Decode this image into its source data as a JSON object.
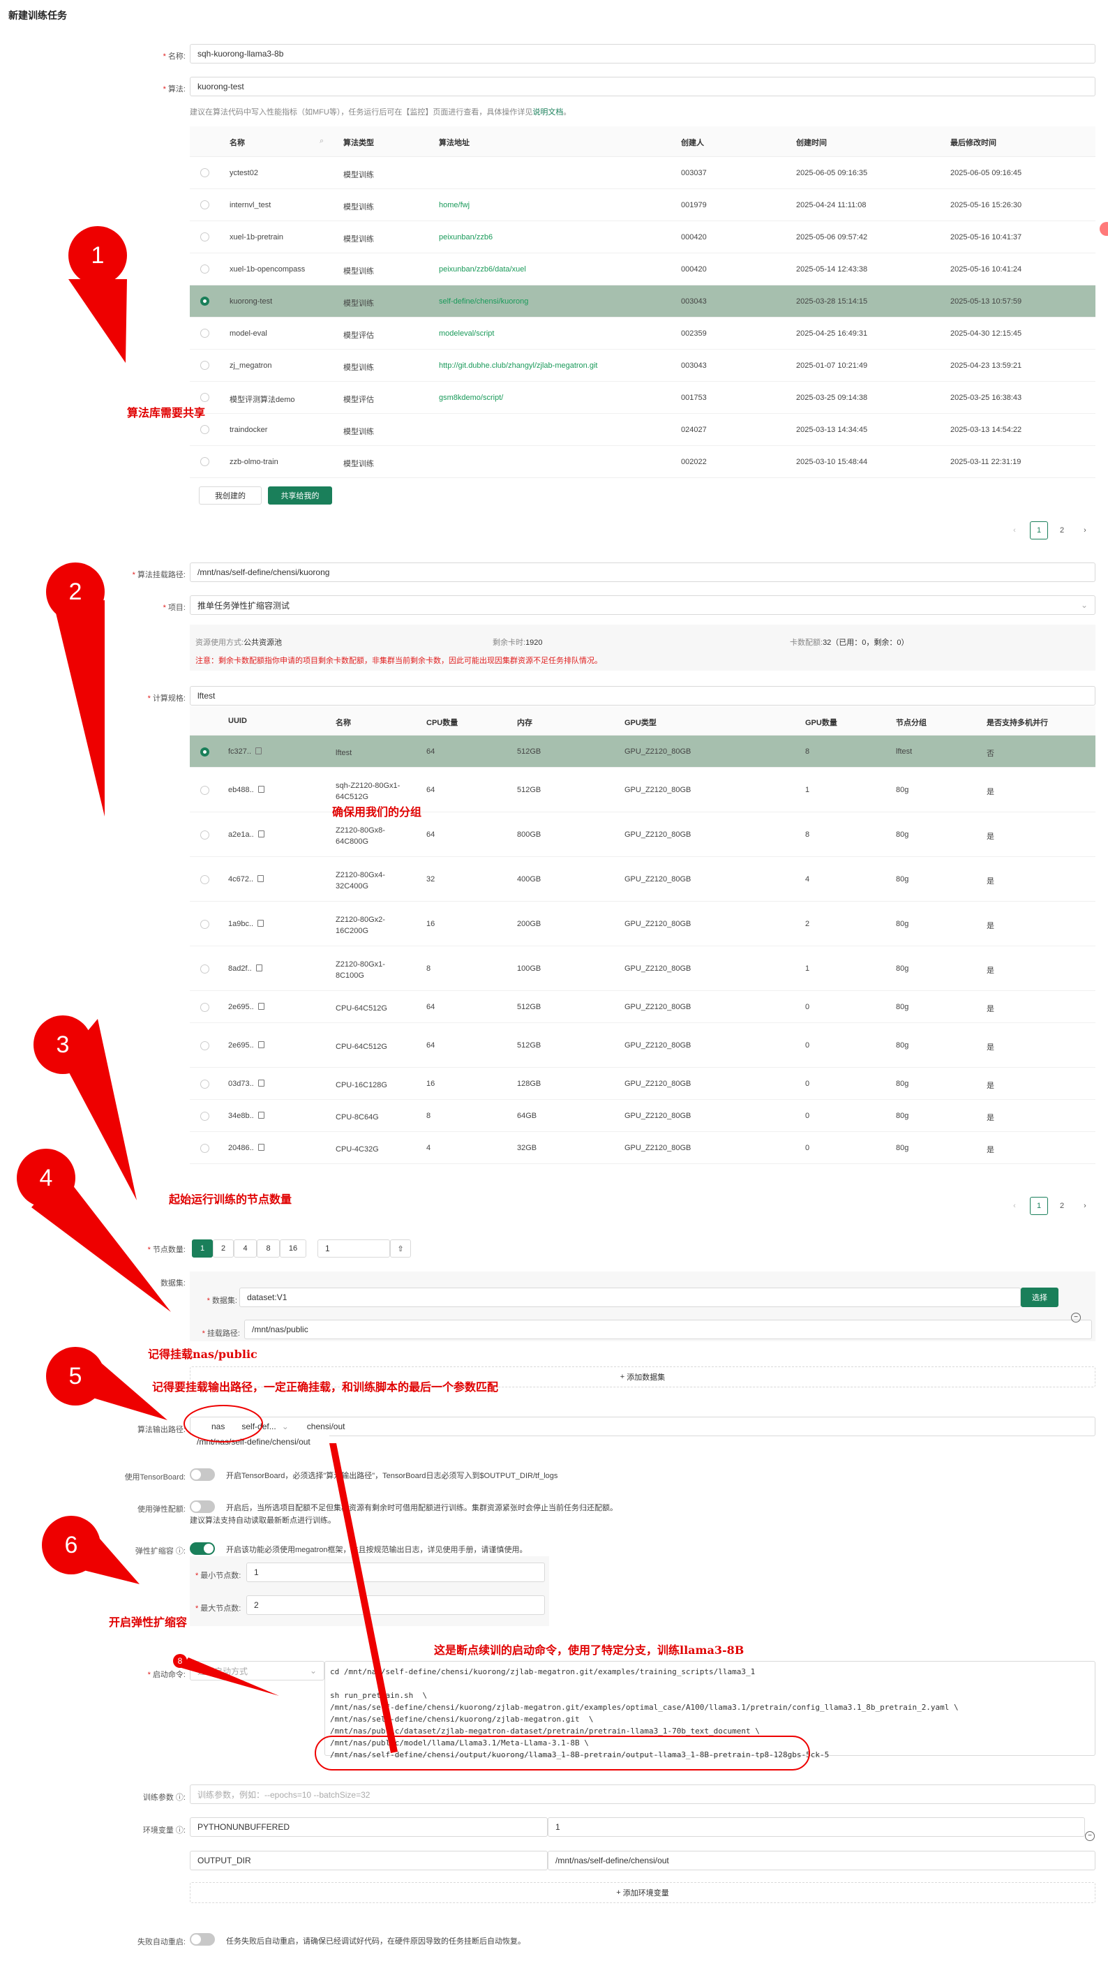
{
  "page_title": "新建训练任务",
  "form": {
    "name_label": "名称:",
    "name_value": "sqh-kuorong-llama3-8b",
    "algo_label": "算法:",
    "algo_value": "kuorong-test",
    "algo_hint_pre": "建议在算法代码中写入性能指标（如MFU等），任务运行后可在【监控】页面进行查看，具体操作详见",
    "algo_hint_link": "说明文档",
    "algo_hint_post": "。"
  },
  "algo_table": {
    "headers": [
      "名称",
      "算法类型",
      "算法地址",
      "创建人",
      "创建时间",
      "最后修改时间"
    ],
    "rows": [
      {
        "name": "yctest02",
        "type": "模型训练",
        "addr": "",
        "creator": "003037",
        "created": "2025-06-05 09:16:35",
        "modified": "2025-06-05 09:16:45"
      },
      {
        "name": "internvl_test",
        "type": "模型训练",
        "addr": "home/fwj",
        "creator": "001979",
        "created": "2025-04-24 11:11:08",
        "modified": "2025-05-16 15:26:30"
      },
      {
        "name": "xuel-1b-pretrain",
        "type": "模型训练",
        "addr": "peixunban/zzb6",
        "creator": "000420",
        "created": "2025-05-06 09:57:42",
        "modified": "2025-05-16 10:41:37"
      },
      {
        "name": "xuel-1b-opencompass",
        "type": "模型训练",
        "addr": "peixunban/zzb6/data/xuel",
        "creator": "000420",
        "created": "2025-05-14 12:43:38",
        "modified": "2025-05-16 10:41:24"
      },
      {
        "name": "kuorong-test",
        "type": "模型训练",
        "addr": "self-define/chensi/kuorong",
        "creator": "003043",
        "created": "2025-03-28 15:14:15",
        "modified": "2025-05-13 10:57:59"
      },
      {
        "name": "model-eval",
        "type": "模型评估",
        "addr": "modeleval/script",
        "creator": "002359",
        "created": "2025-04-25 16:49:31",
        "modified": "2025-04-30 12:15:45"
      },
      {
        "name": "zj_megatron",
        "type": "模型训练",
        "addr": "http://git.dubhe.club/zhangyl/zjlab-megatron.git",
        "creator": "003043",
        "created": "2025-01-07 10:21:49",
        "modified": "2025-04-23 13:59:21"
      },
      {
        "name": "模型评测算法demo",
        "type": "模型评估",
        "addr": "gsm8kdemo/script/",
        "creator": "001753",
        "created": "2025-03-25 09:14:38",
        "modified": "2025-03-25 16:38:43"
      },
      {
        "name": "traindocker",
        "type": "模型训练",
        "addr": "",
        "creator": "024027",
        "created": "2025-03-13 14:34:45",
        "modified": "2025-03-13 14:54:22"
      },
      {
        "name": "zzb-olmo-train",
        "type": "模型训练",
        "addr": "",
        "creator": "002022",
        "created": "2025-03-10 15:48:44",
        "modified": "2025-03-11 22:31:19"
      }
    ],
    "tab_mine": "我创建的",
    "tab_shared": "共享给我的",
    "pages": [
      "1",
      "2"
    ]
  },
  "mount": {
    "label": "算法挂载路径:",
    "value": "/mnt/nas/self-define/chensi/kuorong",
    "project_label": "项目:",
    "project_value": "推单任务弹性扩缩容测试",
    "res_mode_label": "资源使用方式:",
    "res_mode_value": "公共资源池",
    "remain_label": "剩余卡时:",
    "remain_value": "1920",
    "quota_label": "卡数配额:",
    "quota_value": "32（已用：0，剩余：0）",
    "warning": "注意：剩余卡数配额指你申请的项目剩余卡数配额，非集群当前剩余卡数，因此可能出现因集群资源不足任务排队情况。"
  },
  "compute": {
    "label": "计算规格:",
    "search_value": "lftest",
    "headers": [
      "UUID",
      "名称",
      "CPU数量",
      "内存",
      "GPU类型",
      "GPU数量",
      "节点分组",
      "是否支持多机并行"
    ],
    "rows": [
      {
        "uuid": "fc327..",
        "name": "lftest",
        "name2": "",
        "cpu": "64",
        "mem": "512GB",
        "gpu": "GPU_Z2120_80GB",
        "gpun": "8",
        "group": "lftest",
        "multi": "否"
      },
      {
        "uuid": "eb488..",
        "name": "sqh-Z2120-80Gx1-",
        "name2": "64C512G",
        "cpu": "64",
        "mem": "512GB",
        "gpu": "GPU_Z2120_80GB",
        "gpun": "1",
        "group": "80g",
        "multi": "是"
      },
      {
        "uuid": "a2e1a..",
        "name": "Z2120-80Gx8-",
        "name2": "64C800G",
        "cpu": "64",
        "mem": "800GB",
        "gpu": "GPU_Z2120_80GB",
        "gpun": "8",
        "group": "80g",
        "multi": "是"
      },
      {
        "uuid": "4c672..",
        "name": "Z2120-80Gx4-",
        "name2": "32C400G",
        "cpu": "32",
        "mem": "400GB",
        "gpu": "GPU_Z2120_80GB",
        "gpun": "4",
        "group": "80g",
        "multi": "是"
      },
      {
        "uuid": "1a9bc..",
        "name": "Z2120-80Gx2-",
        "name2": "16C200G",
        "cpu": "16",
        "mem": "200GB",
        "gpu": "GPU_Z2120_80GB",
        "gpun": "2",
        "group": "80g",
        "multi": "是"
      },
      {
        "uuid": "8ad2f..",
        "name": "Z2120-80Gx1-",
        "name2": "8C100G",
        "cpu": "8",
        "mem": "100GB",
        "gpu": "GPU_Z2120_80GB",
        "gpun": "1",
        "group": "80g",
        "multi": "是"
      },
      {
        "uuid": "2e695..",
        "name": "CPU-64C512G",
        "name2": "",
        "cpu": "64",
        "mem": "512GB",
        "gpu": "GPU_Z2120_80GB",
        "gpun": "0",
        "group": "80g",
        "multi": "是"
      },
      {
        "uuid": "2e695..",
        "name": "CPU-64C512G",
        "name2": "",
        "cpu": "64",
        "mem": "512GB",
        "gpu": "GPU_Z2120_80GB",
        "gpun": "0",
        "group": "80g",
        "multi": "是"
      },
      {
        "uuid": "03d73..",
        "name": "CPU-16C128G",
        "name2": "",
        "cpu": "16",
        "mem": "128GB",
        "gpu": "GPU_Z2120_80GB",
        "gpun": "0",
        "group": "80g",
        "multi": "是"
      },
      {
        "uuid": "34e8b..",
        "name": "CPU-8C64G",
        "name2": "",
        "cpu": "8",
        "mem": "64GB",
        "gpu": "GPU_Z2120_80GB",
        "gpun": "0",
        "group": "80g",
        "multi": "是"
      },
      {
        "uuid": "20486..",
        "name": "CPU-4C32G",
        "name2": "",
        "cpu": "4",
        "mem": "32GB",
        "gpu": "GPU_Z2120_80GB",
        "gpun": "0",
        "group": "80g",
        "multi": "是"
      }
    ],
    "pages": [
      "1",
      "2"
    ]
  },
  "nodes": {
    "label": "节点数量:",
    "options": [
      "1",
      "2",
      "4",
      "8",
      "16"
    ],
    "selected": "1",
    "custom_value": "1"
  },
  "dataset": {
    "label": "数据集:",
    "ds_label": "数据集:",
    "ds_value": "dataset:V1",
    "select_btn": "选择",
    "mount_label": "挂载路径:",
    "mount_value": "/mnt/nas/public",
    "add_btn": "添加数据集"
  },
  "output": {
    "label": "算法输出路径:",
    "fs": "nas",
    "prefix": "self-def...",
    "sub": "chensi/out",
    "full": "/mnt/nas/self-define/chensi/out"
  },
  "switches": {
    "tb_label": "使用TensorBoard:",
    "tb_text": "开启TensorBoard，必须选择\"算法输出路径\"，TensorBoard日志必须写入到$OUTPUT_DIR/tf_logs",
    "elastic_quota_label": "使用弹性配额:",
    "elastic_quota_text": "开启后，当所选项目配额不足但集群资源有剩余时可借用配额进行训练。集群资源紧张时会停止当前任务归还配额。",
    "elastic_quota_text2": "建议算法支持自动读取最新断点进行训练。",
    "elastic_label": "弹性扩缩容",
    "elastic_text": "开启该功能必须使用megatron框架，并且按规范输出日志，详见使用手册，请谨慎使用。",
    "min_label": "最小节点数:",
    "min_value": "1",
    "max_label": "最大节点数:",
    "max_value": "2"
  },
  "command": {
    "label": "启动命令:",
    "mode_placeholder": "选择启动方式",
    "lines": [
      "cd /mnt/nas/self-define/chensi/kuorong/zjlab-megatron.git/examples/training_scripts/llama3_1",
      "",
      "sh run_pretrain.sh  \\",
      "/mnt/nas/self-define/chensi/kuorong/zjlab-megatron.git/examples/optimal_case/A100/llama3.1/pretrain/config_llama3.1_8b_pretrain_2.yaml \\",
      "/mnt/nas/self-define/chensi/kuorong/zjlab-megatron.git  \\",
      "/mnt/nas/public/dataset/zjlab-megatron-dataset/pretrain/pretrain-llama3_1-70b_text_document \\",
      "/mnt/nas/public/model/llama/Llama3.1/Meta-Llama-3.1-8B \\",
      "/mnt/nas/self-define/chensi/output/kuorong/llama3_1-8B-pretrain/output-llama3_1-8B-pretrain-tp8-128gbs-5ck-5"
    ]
  },
  "params": {
    "label": "训练参数",
    "placeholder": "训练参数，例如：--epochs=10 --batchSize=32"
  },
  "env": {
    "label": "环境变量",
    "rows": [
      {
        "key": "PYTHONUNBUFFERED",
        "value": "1"
      },
      {
        "key": "OUTPUT_DIR",
        "value": "/mnt/nas/self-define/chensi/out"
      }
    ],
    "add_btn": "添加环境变量"
  },
  "restart": {
    "label": "失败自动重启:",
    "text": "任务失败后自动重启，请确保已经调试好代码，在硬件原因导致的任务挂断后自动恢复。"
  },
  "annotations": {
    "c1": "1",
    "c2": "2",
    "c3": "3",
    "c4": "4",
    "c5": "5",
    "c6": "6",
    "a1": "算法库需要共享",
    "a2": "确保用我们的分组",
    "a3": "起始运行训练的节点数量",
    "a4": "记得挂载nas/public",
    "a5": "记得要挂载输出路径，一定正确挂载，和训练脚本的最后一个参数匹配",
    "a6": "开启弹性扩缩容",
    "a7": "这是断点续训的启动命令，使用了特定分支，训练llama3-8B",
    "badge8": "8"
  },
  "colors": {
    "accent": "#1a7f5a",
    "selected_row": "#a6bfae",
    "annotation": "#e00000"
  }
}
